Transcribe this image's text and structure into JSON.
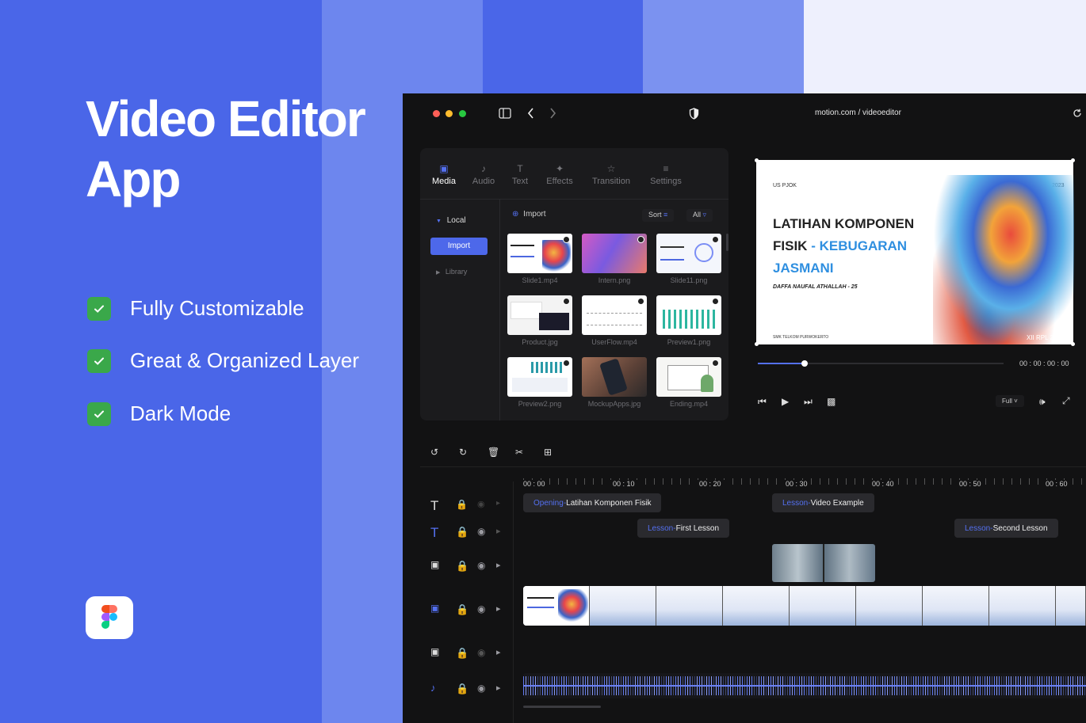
{
  "hero": {
    "title_line1": "Video Editor",
    "title_line2": "App"
  },
  "features": [
    {
      "label": "Fully Customizable"
    },
    {
      "label": "Great & Organized Layer"
    },
    {
      "label": "Dark Mode"
    }
  ],
  "browser": {
    "url": "motion.com / videoeditor"
  },
  "tabs": [
    {
      "label": "Media",
      "icon": "media-icon"
    },
    {
      "label": "Audio",
      "icon": "music-note-icon"
    },
    {
      "label": "Text",
      "icon": "text-icon"
    },
    {
      "label": "Effects",
      "icon": "magic-wand-icon"
    },
    {
      "label": "Transition",
      "icon": "transition-icon"
    },
    {
      "label": "Settings",
      "icon": "sliders-icon"
    }
  ],
  "library": {
    "local": "Local",
    "import_btn": "Import",
    "library": "Library"
  },
  "media_toolbar": {
    "import": "Import",
    "sort": "Sort",
    "all": "All"
  },
  "media_items": [
    {
      "name": "Slide1.mp4"
    },
    {
      "name": "Intern.png"
    },
    {
      "name": "Slide11.png"
    },
    {
      "name": "Product.jpg"
    },
    {
      "name": "UserFlow.mp4"
    },
    {
      "name": "Preview1.png"
    },
    {
      "name": "Preview2.png"
    },
    {
      "name": "MockupApps.jpg"
    },
    {
      "name": "Ending.mp4"
    }
  ],
  "preview": {
    "header_left": "US PJOK",
    "header_right": "2023",
    "title_line1": "LATIHAN KOMPONEN",
    "title_line2_a": "FISIK",
    "title_line2_b": "- KEBUGARAN",
    "title_line3": "JASMANI",
    "author": "DAFFA NAUFAL ATHALLAH - 25",
    "footer_left": "SMK TELKOM PURWOKERTO",
    "footer_right": "XII RPL 2",
    "timecode": "00 : 00 : 00 : 00",
    "progress": 0.19,
    "quality": "Full"
  },
  "timeline": {
    "times": [
      "00 : 00",
      "00 : 10",
      "00 : 20",
      "00 : 30",
      "00 : 40",
      "00 : 50",
      "00 : 60"
    ],
    "clips": [
      {
        "pre": "Opening",
        "sep": " - ",
        "name": "Latihan Komponen Fisik"
      },
      {
        "pre": "Lesson",
        "sep": " - ",
        "name": "Video Example"
      },
      {
        "pre": "Lesson",
        "sep": " - ",
        "name": "First Lesson"
      },
      {
        "pre": "Lesson",
        "sep": " - ",
        "name": "Second Lesson"
      }
    ]
  },
  "colors": {
    "accent": "#5470f0",
    "background": "#4a66e8",
    "panel": "#1b1b1d",
    "check": "#3aa84a"
  }
}
